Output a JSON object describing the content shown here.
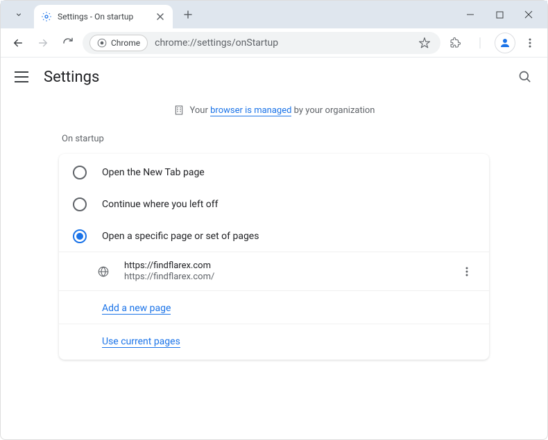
{
  "window": {
    "tab_title": "Settings - On startup",
    "url": "chrome://settings/onStartup",
    "chrome_chip": "Chrome"
  },
  "settings": {
    "title": "Settings",
    "managed_prefix": "Your ",
    "managed_link": "browser is managed",
    "managed_suffix": " by your organization",
    "section_title": "On startup",
    "options": [
      {
        "label": "Open the New Tab page",
        "selected": false
      },
      {
        "label": "Continue where you left off",
        "selected": false
      },
      {
        "label": "Open a specific page or set of pages",
        "selected": true
      }
    ],
    "pages": [
      {
        "title": "https://findflarex.com",
        "url": "https://findflarex.com/"
      }
    ],
    "add_link": "Add a new page",
    "use_current_link": "Use current pages"
  }
}
